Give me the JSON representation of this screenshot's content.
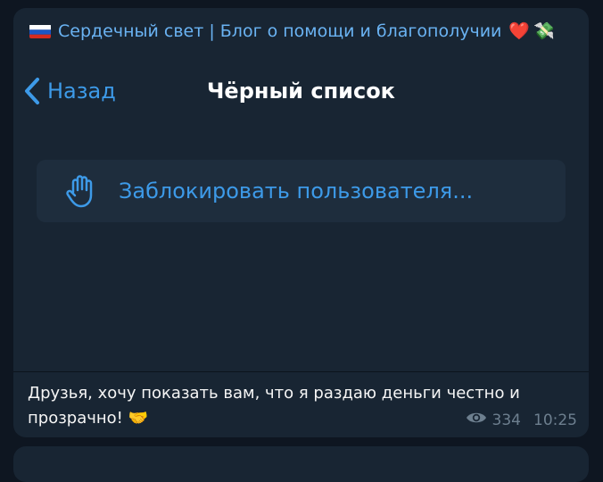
{
  "channel": {
    "flag_icon": "russia-flag-icon",
    "name": "Сердечный свет | Блог о помощи и благополучии",
    "emoji": [
      "heart-emoji",
      "money-with-wings-emoji"
    ]
  },
  "screenshot": {
    "back_label": "Назад",
    "title": "Чёрный список",
    "block_user_label": "Заблокировать пользователя...",
    "block_icon": "hand-icon"
  },
  "message": {
    "text": "Друзья, хочу показать вам, что я раздаю деньги честно и прозрачно! 🤝",
    "views": "334",
    "time": "10:25"
  },
  "colors": {
    "background": "#0e1621",
    "bubble": "#182533",
    "accent": "#3d9ae8",
    "channel_name": "#6ab3f3",
    "meta": "#6d7f8f"
  }
}
